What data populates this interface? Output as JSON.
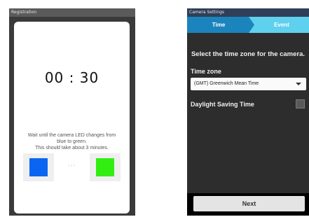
{
  "registration": {
    "title": "Registration",
    "timer": "00 : 30",
    "wait_line1": "Wait until the camera LED changes from",
    "wait_line2": "blue to green.",
    "wait_line3": "This should take about 3 minutes.",
    "arrows": "› › ›",
    "colors": {
      "blue_led": "#0a66f0",
      "green_led": "#33ee11"
    }
  },
  "camera_settings": {
    "title": "Camera Settings",
    "steps": [
      {
        "label": "Time",
        "active": true
      },
      {
        "label": "Event",
        "active": false
      }
    ],
    "prompt": "Select the time zone for the camera.",
    "timezone_label": "Time zone",
    "timezone_value": "(GMT) Greenwich Mean Time",
    "dst_label": "Daylight Saving Time",
    "dst_checked": false,
    "next_label": "Next",
    "colors": {
      "step_active": "#1c84bd",
      "step_inactive": "#5fd0ee"
    }
  }
}
